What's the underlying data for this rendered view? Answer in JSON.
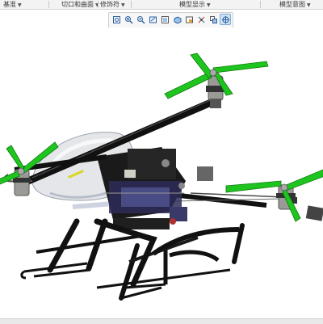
{
  "ribbon": {
    "groups": [
      {
        "label": "基准"
      },
      {
        "label": "切口和曲面"
      },
      {
        "label": "修饰符"
      },
      {
        "label": "模型显示"
      },
      {
        "label": "模型意图"
      }
    ]
  },
  "view_toolbar": {
    "buttons": [
      {
        "icon": "refit-icon",
        "active": false
      },
      {
        "icon": "zoom-in-icon",
        "active": false
      },
      {
        "icon": "zoom-out-icon",
        "active": false
      },
      {
        "icon": "repaint-icon",
        "active": false
      },
      {
        "icon": "named-views-icon",
        "active": false
      },
      {
        "icon": "display-style-icon",
        "active": false
      },
      {
        "icon": "saved-orientations-icon",
        "active": false
      },
      {
        "icon": "datum-display-icon",
        "active": false
      },
      {
        "icon": "view-manager-icon",
        "active": false
      },
      {
        "icon": "spin-center-icon",
        "active": true
      }
    ]
  },
  "model": {
    "name": "quadcopter-assembly",
    "colors": {
      "propeller": "#1fc51f",
      "frame": "#111111",
      "canopy": "#e4e6ea",
      "motor": "#9a9a96",
      "skid": "#222222",
      "accent": "#d8d81e"
    }
  }
}
